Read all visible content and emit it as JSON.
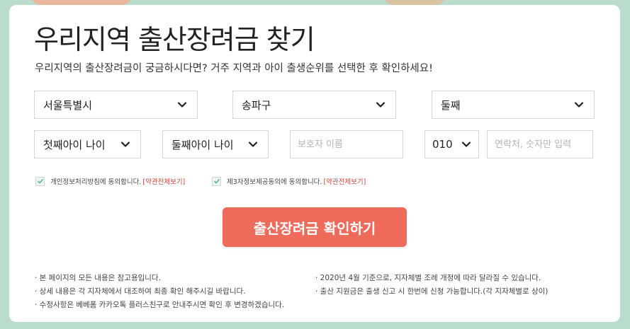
{
  "page": {
    "title": "우리지역 출산장려금 찾기",
    "subtitle": "우리지역의 출산장려금이 궁금하시다면? 거주 지역과 아이 출생순위를 선택한 후 확인하세요!"
  },
  "form": {
    "city": "서울특별시",
    "district": "송파구",
    "birth_order": "둘째",
    "first_child_age": "첫째아이 나이",
    "second_child_age": "둘째아이 나이",
    "guardian_name_placeholder": "보호자 이름",
    "phone_prefix": "010",
    "phone_placeholder": "연락처, 숫자만 입력"
  },
  "agreements": [
    {
      "label": "개인정보처리방침에 동의합니다.",
      "link": "[약관전체보기]"
    },
    {
      "label": "제3자정보제공동의에 동의합니다.",
      "link": "[약관전체보기]"
    }
  ],
  "cta": {
    "label": "출산장려금 확인하기"
  },
  "notes": [
    "· 본 페이지의 모든 내용은 참고용입니다.",
    "· 상세 내용은 각 지자체에서 대조하여 최종 확인 해주시길 바랍니다.",
    "· 수정사항은 베베폼 카카오톡 플러스친구로 안내주시면 확인 후 변경하겠습니다.",
    "· 2020년 4월 기준으로, 지자체별 조례 개정에 따라 달라질 수 있습니다.",
    "· 출산 지원금은 출생 신고 시 한번에 신청 가능합니다.(각 지자체별로 상이)"
  ],
  "colors": {
    "background": "#b9dccc",
    "cta": "#ee6a5b",
    "terms_link": "#c9423a"
  },
  "icons": {
    "dropdown": "chevron-down-icon",
    "check": "check-icon"
  }
}
